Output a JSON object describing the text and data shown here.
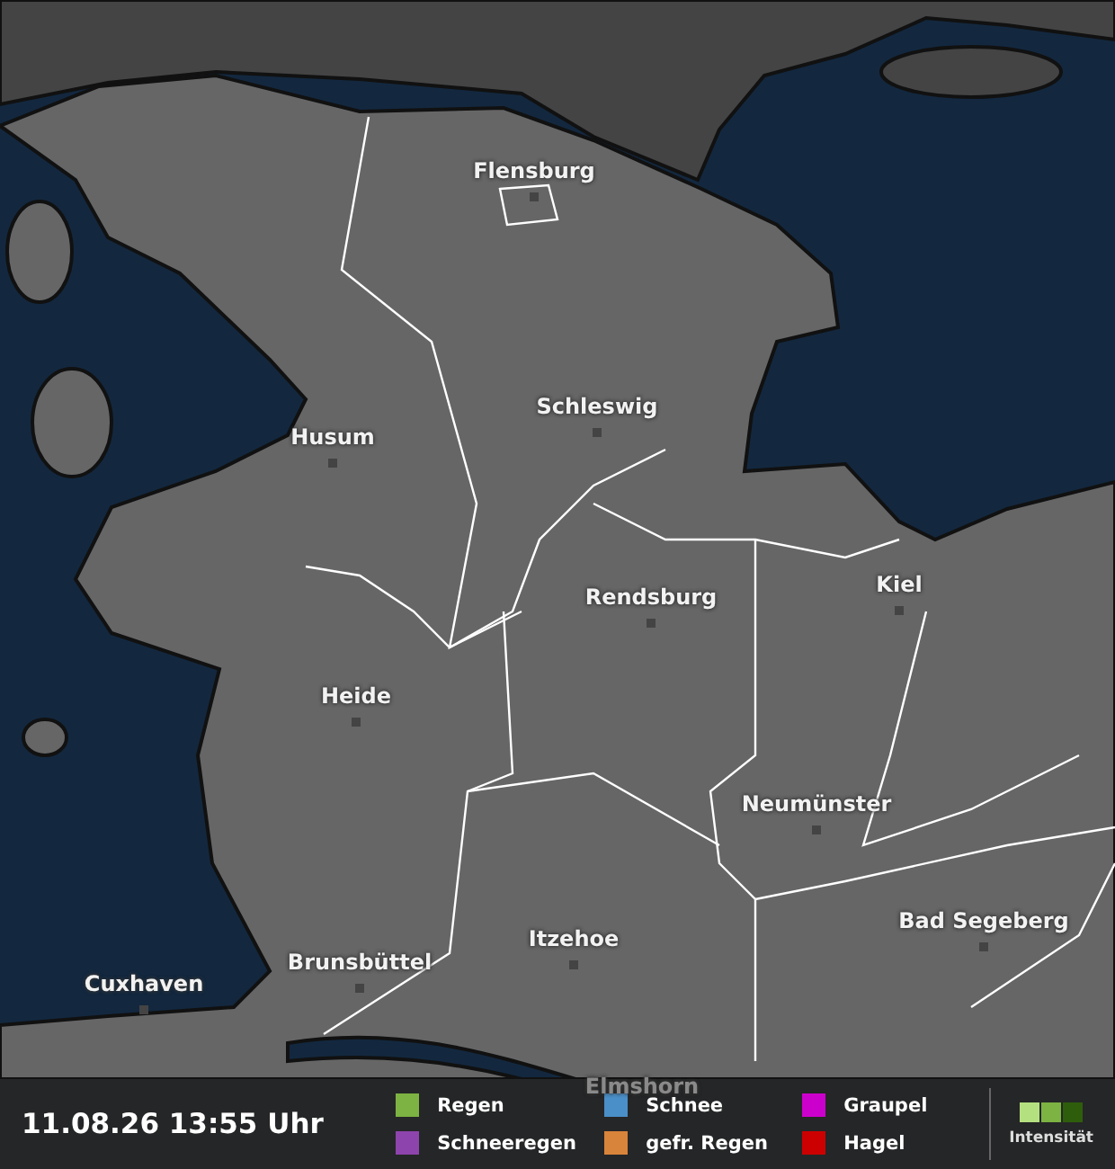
{
  "map": {
    "cities": [
      "Flensburg",
      "Schleswig",
      "Husum",
      "Rendsburg",
      "Kiel",
      "Heide",
      "Neumünster",
      "Bad Segeberg",
      "Itzehoe",
      "Brunsbüttel",
      "Cuxhaven",
      "Elmshorn"
    ]
  },
  "timestamp": "11.08.26 13:55 Uhr",
  "legend": [
    {
      "label": "Regen",
      "color": "#7cb342"
    },
    {
      "label": "Schneeregen",
      "color": "#8e44ad"
    },
    {
      "label": "Schnee",
      "color": "#4a8fc7"
    },
    {
      "label": "gefr. Regen",
      "color": "#d9843b"
    },
    {
      "label": "Graupel",
      "color": "#cc00cc"
    },
    {
      "label": "Hagel",
      "color": "#cc0000"
    }
  ],
  "intensity": {
    "label": "Intensität"
  }
}
